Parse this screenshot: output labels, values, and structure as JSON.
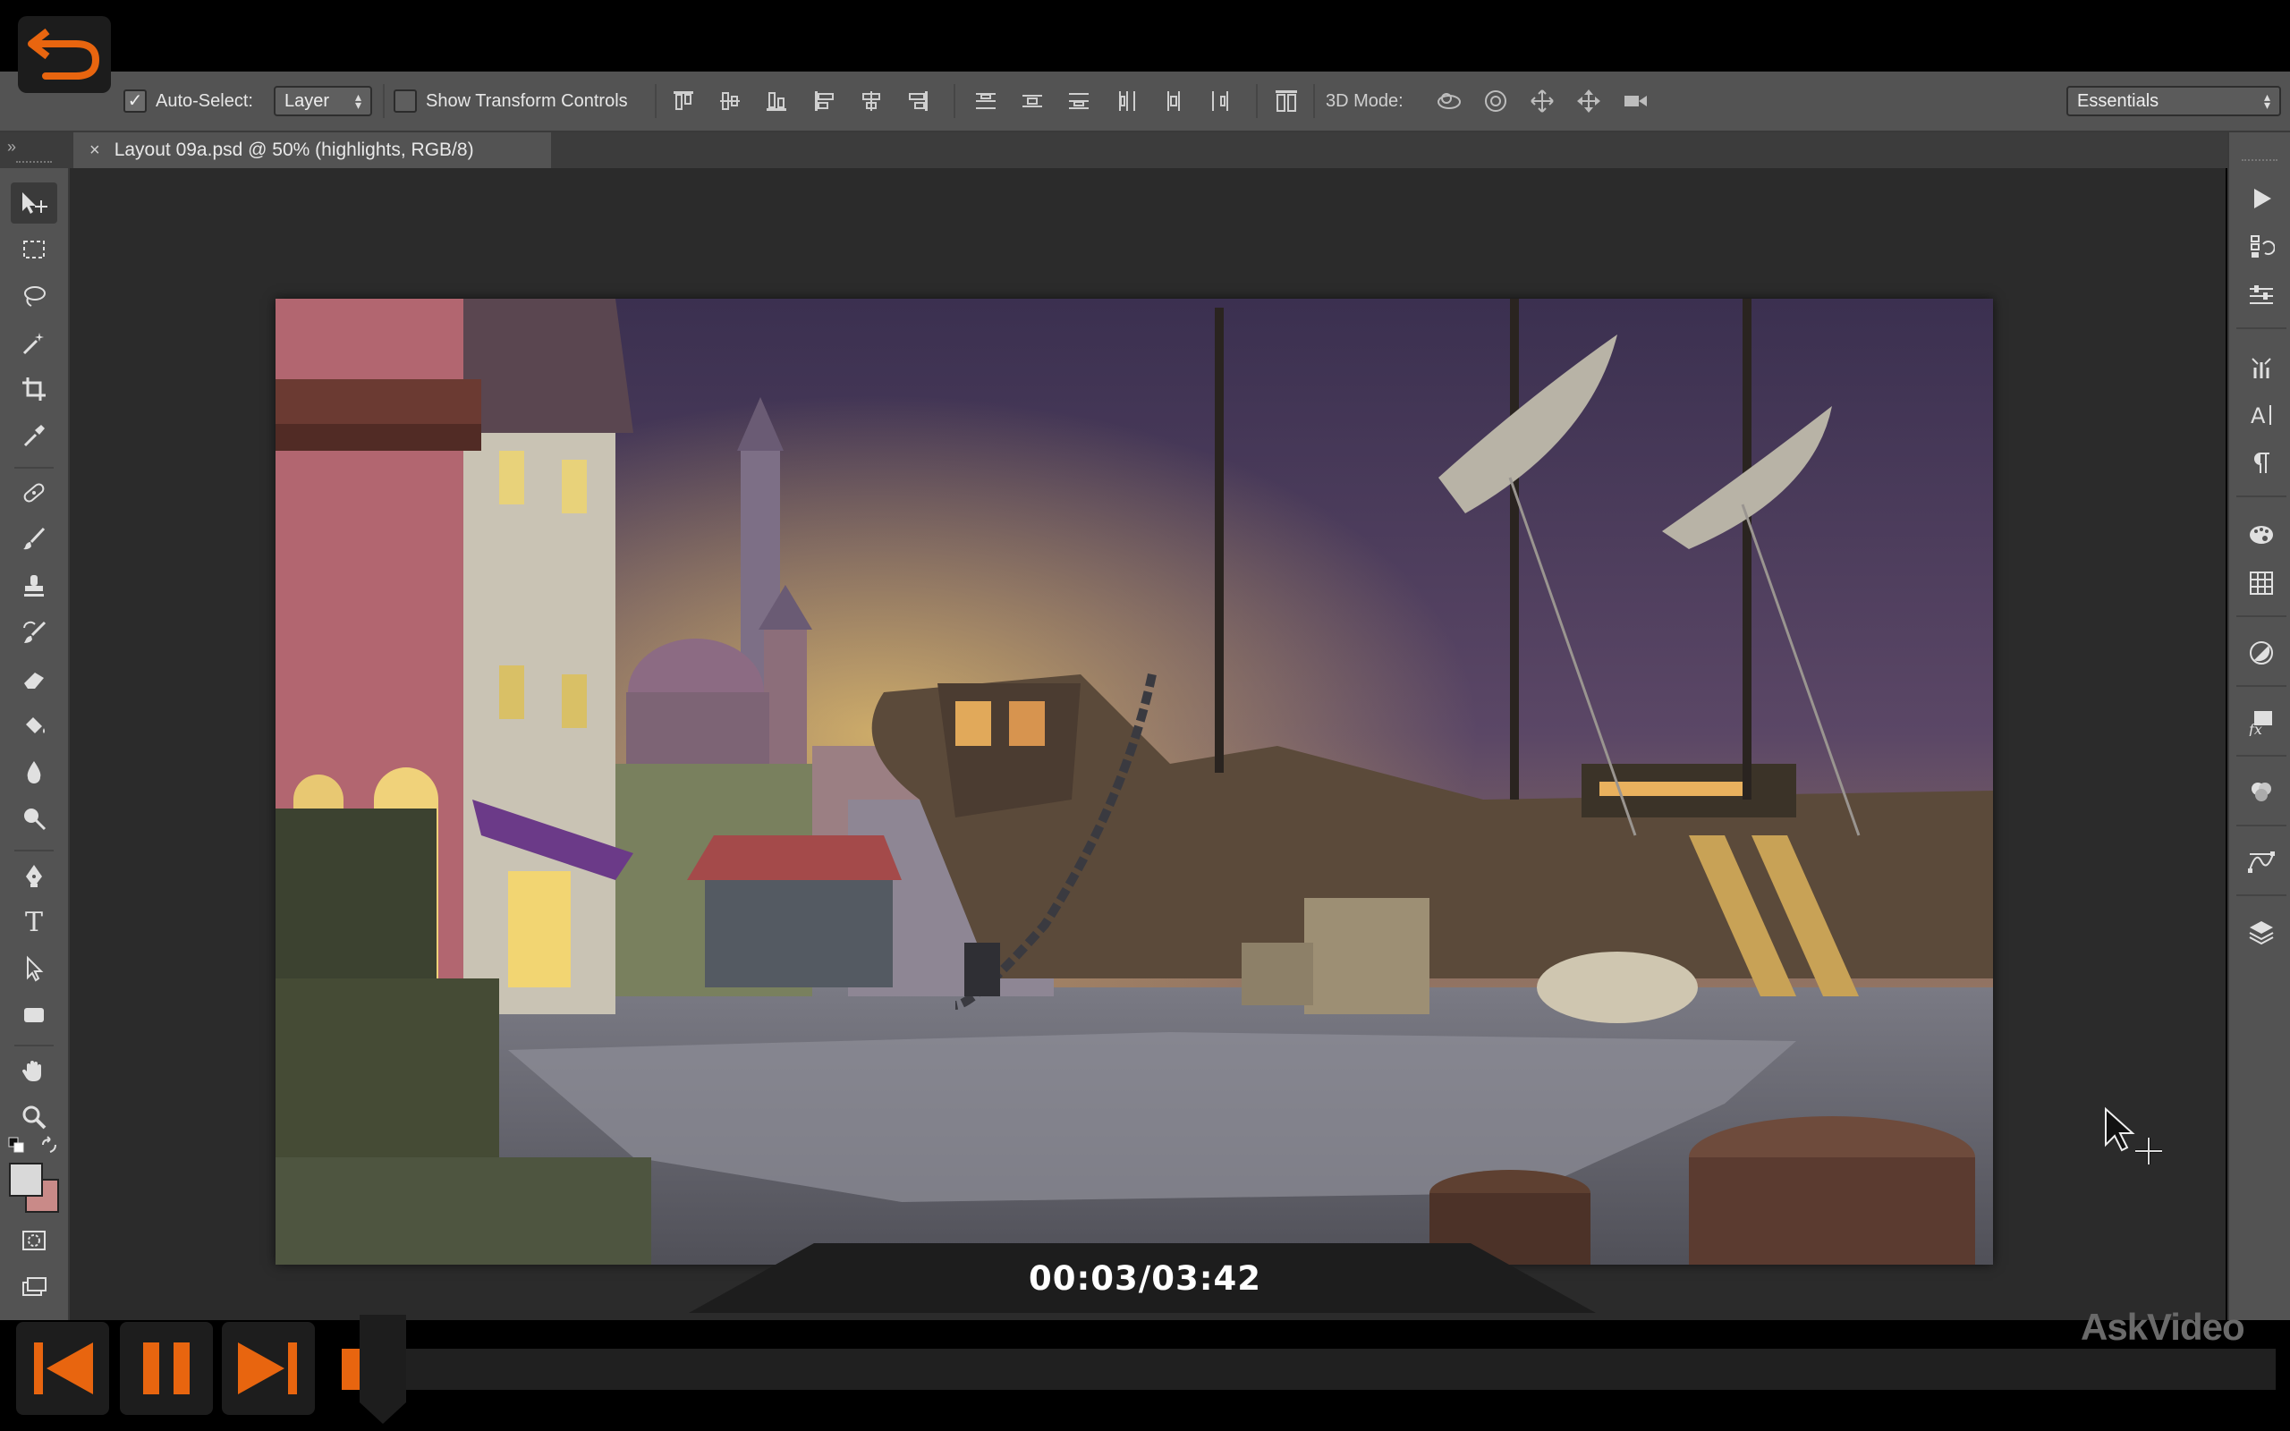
{
  "options_bar": {
    "auto_select_label": "Auto-Select:",
    "auto_select_checked": true,
    "auto_select_value": "Layer",
    "show_transform_label": "Show Transform Controls",
    "show_transform_checked": false,
    "mode_3d_label": "3D Mode:",
    "workspace_value": "Essentials"
  },
  "document_tab": {
    "title": "Layout 09a.psd @ 50% (highlights, RGB/8)",
    "close_glyph": "×"
  },
  "tools": [
    "move-tool",
    "marquee-tool",
    "lasso-tool",
    "magic-wand-tool",
    "crop-tool",
    "eyedropper-tool",
    "healing-brush-tool",
    "brush-tool",
    "clone-stamp-tool",
    "history-brush-tool",
    "eraser-tool",
    "paint-bucket-tool",
    "blur-tool",
    "dodge-tool",
    "pen-tool",
    "type-tool",
    "path-selection-tool",
    "rectangle-tool",
    "hand-tool",
    "zoom-tool"
  ],
  "type_tool_glyph": "T",
  "colors": {
    "accent": "#e8650f",
    "foreground_swatch": "#d9d9d9",
    "background_swatch": "#c98a88"
  },
  "player": {
    "timecode": "00:03/03:42",
    "progress": 0.0135,
    "watermark": "AskVideo"
  }
}
